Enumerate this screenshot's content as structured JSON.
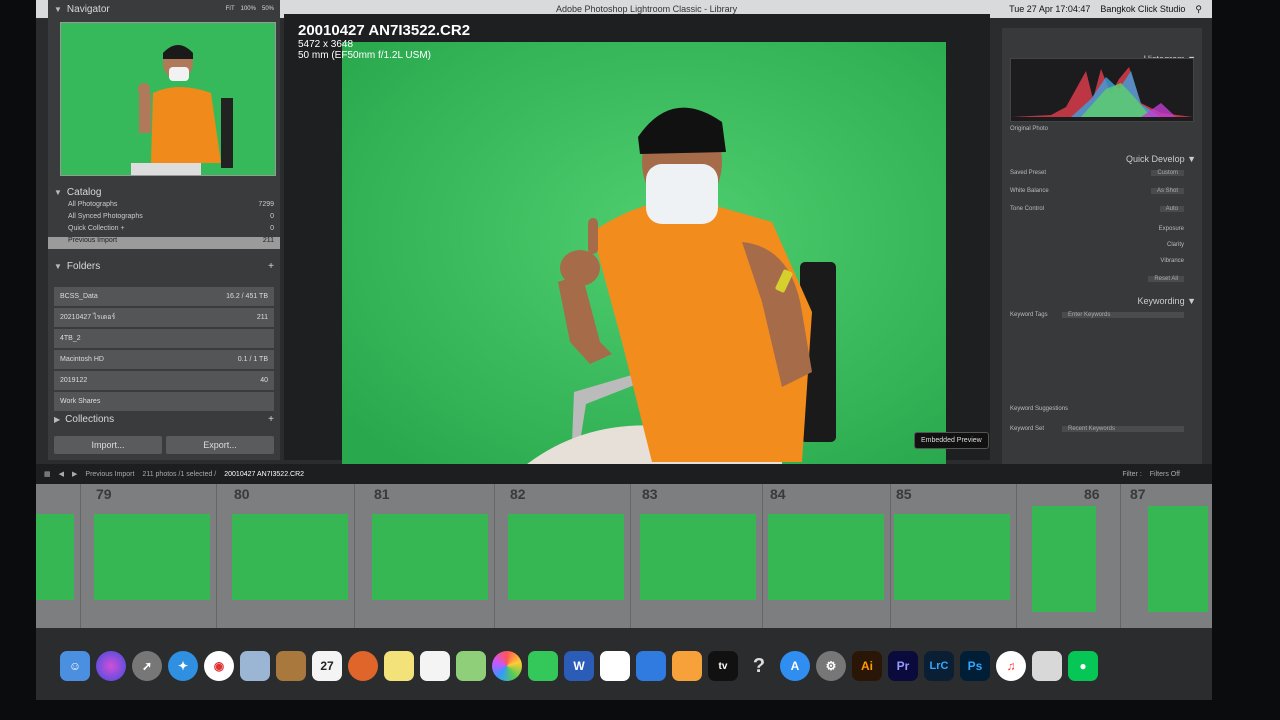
{
  "window": {
    "title": "Adobe Photoshop Lightroom Classic - Library",
    "clock": "Tue 27 Apr 17:04:47",
    "studio": "Bangkok Click Studio"
  },
  "navigator": {
    "title": "Navigator",
    "zoom_options": [
      "FIT",
      "100%",
      "50%"
    ]
  },
  "catalog": {
    "title": "Catalog",
    "items": [
      {
        "label": "All Photographs",
        "count": "7299"
      },
      {
        "label": "All Synced Photographs",
        "count": "0"
      },
      {
        "label": "Quick Collection +",
        "count": "0"
      },
      {
        "label": "Previous Import",
        "count": "211"
      }
    ]
  },
  "folders": {
    "title": "Folders",
    "items": [
      {
        "label": "BCSS_Data",
        "count": "16.2 / 451 TB"
      },
      {
        "label": "20210427 ไรเดอร์",
        "count": "211"
      },
      {
        "label": "4TB_2",
        "count": ""
      },
      {
        "label": "Macintosh HD",
        "count": "0.1 / 1 TB"
      },
      {
        "label": "2019122",
        "count": "40"
      },
      {
        "label": "Work Shares",
        "count": ""
      }
    ]
  },
  "collections": {
    "title": "Collections"
  },
  "buttons": {
    "import": "Import...",
    "export": "Export..."
  },
  "photo": {
    "filename": "20010427 AN7I3522.CR2",
    "dimensions": "5472 x 3648",
    "lens": "50 mm (EF50mm f/1.2L USM)",
    "badge": "Embedded Preview"
  },
  "right_panel": {
    "histogram_title": "Histogram",
    "original_photo": "Original Photo",
    "quick_develop_title": "Quick Develop",
    "saved_preset_label": "Saved Preset",
    "saved_preset_value": "Custom",
    "white_balance_label": "White Balance",
    "white_balance_value": "As Shot",
    "tone_control_label": "Tone Control",
    "tone_control_value": "Auto",
    "exposure_label": "Exposure",
    "clarity_label": "Clarity",
    "vibrance_label": "Vibrance",
    "reset_all": "Reset All",
    "keywording_title": "Keywording",
    "keyword_tags_label": "Keyword Tags",
    "keyword_tags_placeholder": "Enter Keywords",
    "keyword_suggestions": "Keyword Suggestions",
    "keyword_set_label": "Keyword Set",
    "keyword_set_value": "Recent Keywords"
  },
  "filmstrip": {
    "source": "Previous Import",
    "summary": "211 photos /1 selected /",
    "selected_file": "20010427 AN7I3522.CR2",
    "filter_label": "Filter :",
    "filters_off": "Filters Off",
    "numbers": [
      "79",
      "80",
      "81",
      "82",
      "83",
      "84",
      "85",
      "86",
      "87"
    ]
  },
  "dock": {
    "apps": [
      "finder",
      "siri",
      "launchpad",
      "safari",
      "chrome",
      "preview",
      "notes-folder",
      "calendar",
      "fl-studio",
      "notes",
      "reminders",
      "maps",
      "photos",
      "facetime",
      "word",
      "numbers",
      "keynote",
      "pages",
      "tv",
      "help",
      "app-store",
      "system-preferences",
      "illustrator",
      "premiere",
      "lightroom-classic",
      "photoshop",
      "music",
      "books",
      "line"
    ],
    "labels": {
      "tv": "tv",
      "help": "?",
      "ai": "Ai",
      "pr": "Pr",
      "lrc": "LrC",
      "ps": "Ps",
      "calendar": "27"
    }
  }
}
